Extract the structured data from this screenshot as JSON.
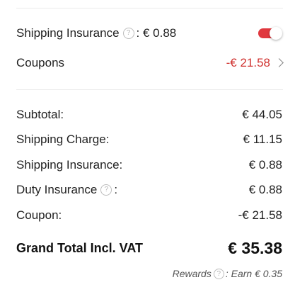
{
  "options": {
    "shipping_insurance": {
      "label": "Shipping Insurance",
      "suffix": ": € 0.88",
      "help_icon": "help-circle-icon",
      "enabled": true
    },
    "coupons": {
      "label": "Coupons",
      "value": "-€ 21.58",
      "icon": "chevron-right-icon"
    }
  },
  "summary": {
    "subtotal": {
      "label": "Subtotal:",
      "value": "€ 44.05"
    },
    "shipping_charge": {
      "label": "Shipping Charge:",
      "value": "€ 11.15"
    },
    "shipping_insurance": {
      "label": "Shipping Insurance:",
      "value": "€ 0.88"
    },
    "duty_insurance": {
      "label": "Duty Insurance",
      "suffix": ":",
      "value": "€ 0.88",
      "help_icon": "help-circle-icon"
    },
    "coupon": {
      "label": "Coupon:",
      "value": "-€ 21.58"
    }
  },
  "grand_total": {
    "label": "Grand Total Incl. VAT",
    "value": "€ 35.38"
  },
  "rewards": {
    "label": "Rewards",
    "value": ": Earn € 0.35",
    "help_icon": "help-circle-icon"
  },
  "colors": {
    "accent": "#e0383e",
    "coupon_text": "#d0322f",
    "divider": "#ececec"
  }
}
